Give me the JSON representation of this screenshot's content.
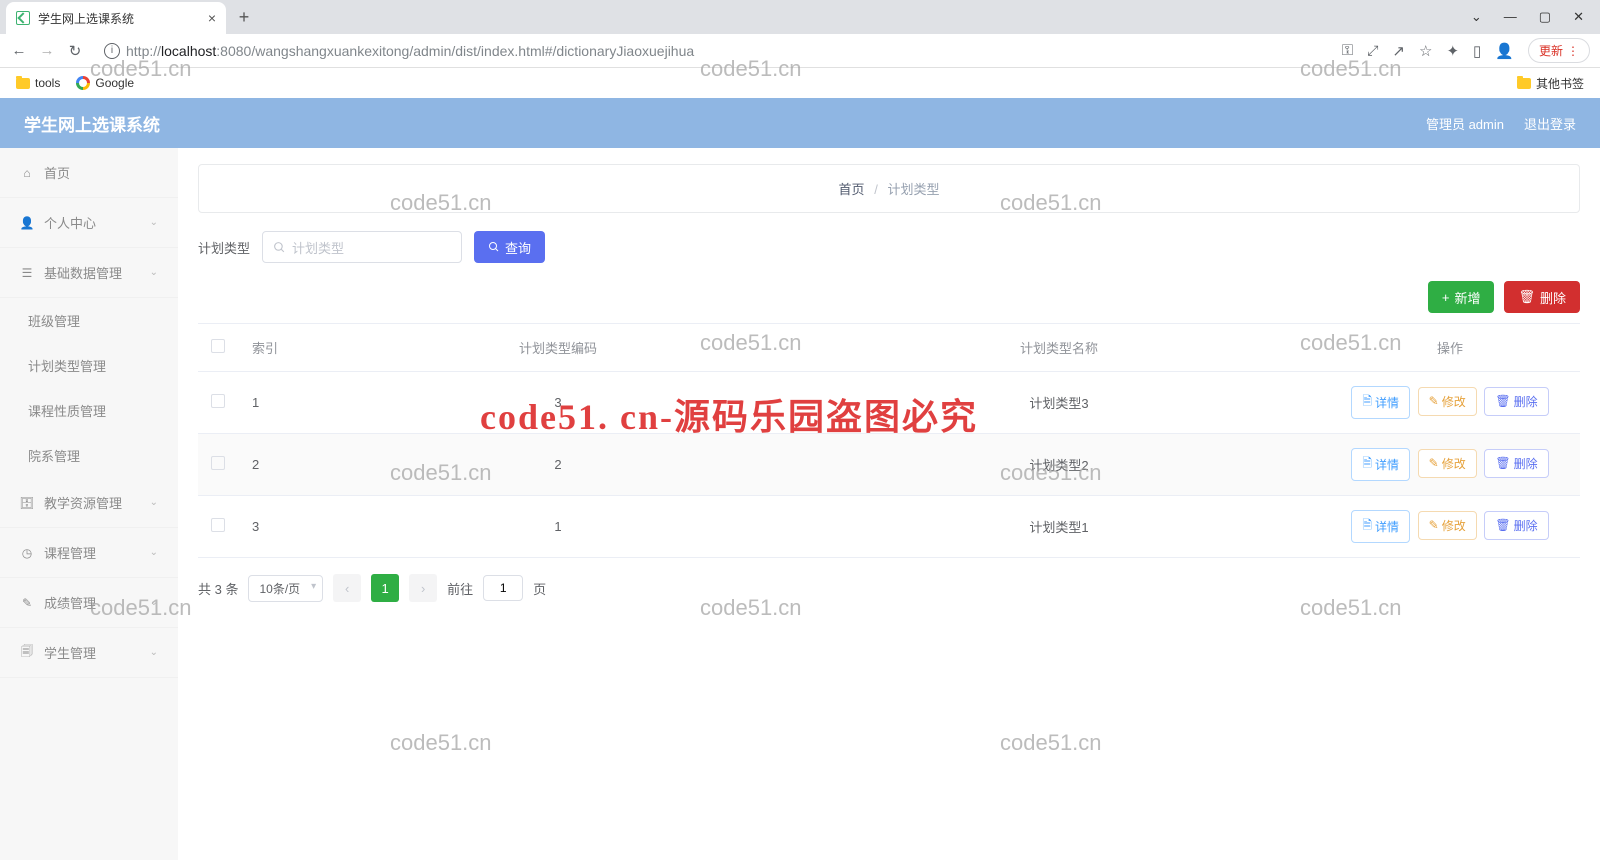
{
  "browser": {
    "tab_title": "学生网上选课系统",
    "url_host": "localhost",
    "url_prefix": "http://",
    "url_port_path": ":8080/wangshangxuankexitong/admin/dist/index.html#/dictionaryJiaoxuejihua",
    "update_btn": "更新",
    "bookmarks": {
      "tools": "tools",
      "google": "Google",
      "other": "其他书签"
    }
  },
  "header": {
    "brand": "学生网上选课系统",
    "user": "管理员 admin",
    "logout": "退出登录"
  },
  "sidebar": {
    "home": "首页",
    "profile": "个人中心",
    "base": "基础数据管理",
    "base_subs": [
      "班级管理",
      "计划类型管理",
      "课程性质管理",
      "院系管理"
    ],
    "teach": "教学资源管理",
    "course": "课程管理",
    "grade": "成绩管理",
    "student": "学生管理"
  },
  "breadcrumb": {
    "home": "首页",
    "current": "计划类型"
  },
  "filter": {
    "label": "计划类型",
    "placeholder": "计划类型",
    "search_btn": "查询"
  },
  "actions": {
    "add": "新增",
    "delete": "删除"
  },
  "table": {
    "headers": {
      "index": "索引",
      "code": "计划类型编码",
      "name": "计划类型名称",
      "ops": "操作"
    },
    "rows": [
      {
        "idx": "1",
        "code": "3",
        "name": "计划类型3"
      },
      {
        "idx": "2",
        "code": "2",
        "name": "计划类型2"
      },
      {
        "idx": "3",
        "code": "1",
        "name": "计划类型1"
      }
    ],
    "row_btns": {
      "detail": "详情",
      "edit": "修改",
      "del": "删除"
    }
  },
  "pagination": {
    "total": "共 3 条",
    "per_page": "10条/页",
    "page": "1",
    "goto_prefix": "前往",
    "goto_suffix": "页",
    "goto_value": "1"
  },
  "watermark": "code51.cn",
  "watermark_red": "code51. cn-源码乐园盗图必究"
}
